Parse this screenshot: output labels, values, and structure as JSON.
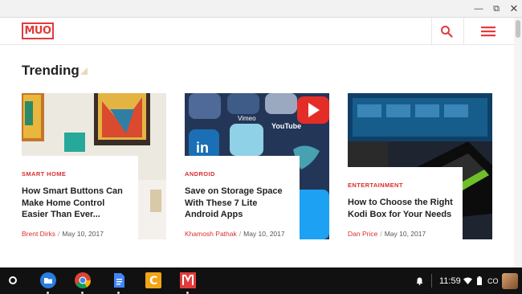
{
  "window": {
    "minimize": "—",
    "maximize": "⧉",
    "close": "✕"
  },
  "header": {
    "logo_text": "MUO",
    "search_icon": "search-icon",
    "menu_icon": "hamburger-menu-icon",
    "accent": "#e33b3b"
  },
  "section": {
    "title": "Trending"
  },
  "cards": [
    {
      "category": "SMART HOME",
      "title_lines": [
        "How Smart Buttons Can",
        "Make Home Control",
        "Easier Than Ever..."
      ],
      "author": "Brent Dirks",
      "date": "May 10, 2017"
    },
    {
      "category": "ANDROID",
      "title_lines": [
        "Save on Storage Space",
        "With These 7 Lite",
        "Android Apps"
      ],
      "author": "Khamosh Pathak",
      "date": "May 10, 2017",
      "image_labels": [
        "Vimeo",
        "YouTube",
        "in"
      ]
    },
    {
      "category": "ENTERTAINMENT",
      "title_lines": [
        "How to Choose the Right",
        "Kodi Box for Your Needs"
      ],
      "author": "Dan Price",
      "date": "May 10, 2017"
    }
  ],
  "meta_separator": "/",
  "shelf": {
    "apps": [
      "files-app-icon",
      "chrome-icon",
      "docs-icon",
      "c-app-icon",
      "muo-app-icon"
    ],
    "clock": "11:59",
    "locale": "CO"
  }
}
